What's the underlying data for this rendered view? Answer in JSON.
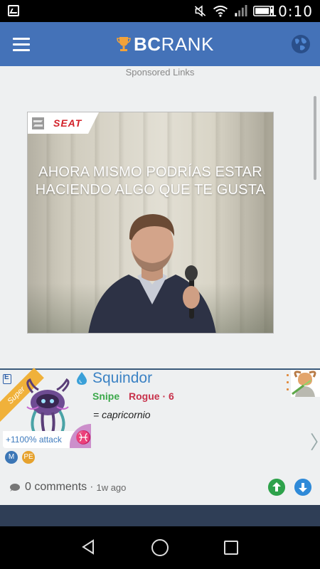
{
  "status_bar": {
    "time": "10:10",
    "icons": [
      "image-icon",
      "mute-icon",
      "wifi-icon",
      "signal-icon",
      "battery-icon"
    ]
  },
  "app_bar": {
    "brand_bold": "BC",
    "brand_rest": "RANK",
    "icons": [
      "hamburger-menu-icon",
      "trophy-icon",
      "globe-icon"
    ]
  },
  "content": {
    "sponsored_label": "Sponsored Links",
    "ad": {
      "brand": "SEAT",
      "headline_line1": "AHORA MISMO PODRÍAS ESTAR",
      "headline_line2": "HACIENDO ALGO QUE TE GUSTA"
    }
  },
  "post": {
    "ribbon": "Super",
    "attack_text": "+1100% attack",
    "zodiac_symbol": "♓",
    "player_name": "Squindor",
    "class_primary": "Snipe",
    "class_secondary": "Rogue · 6",
    "quote": "= capricornio",
    "badges": [
      "M",
      "PE"
    ],
    "comments_label": "0 comments",
    "separator": "·",
    "time_ago": "1w ago"
  },
  "colors": {
    "appbar": "#4472b8",
    "name_blue": "#3b82c4",
    "snipe_green": "#3ba84a",
    "rogue_red": "#c8324b",
    "ribbon_gold": "#f0b13a",
    "upvote": "#2ea24b",
    "downvote": "#2f8ad8"
  }
}
